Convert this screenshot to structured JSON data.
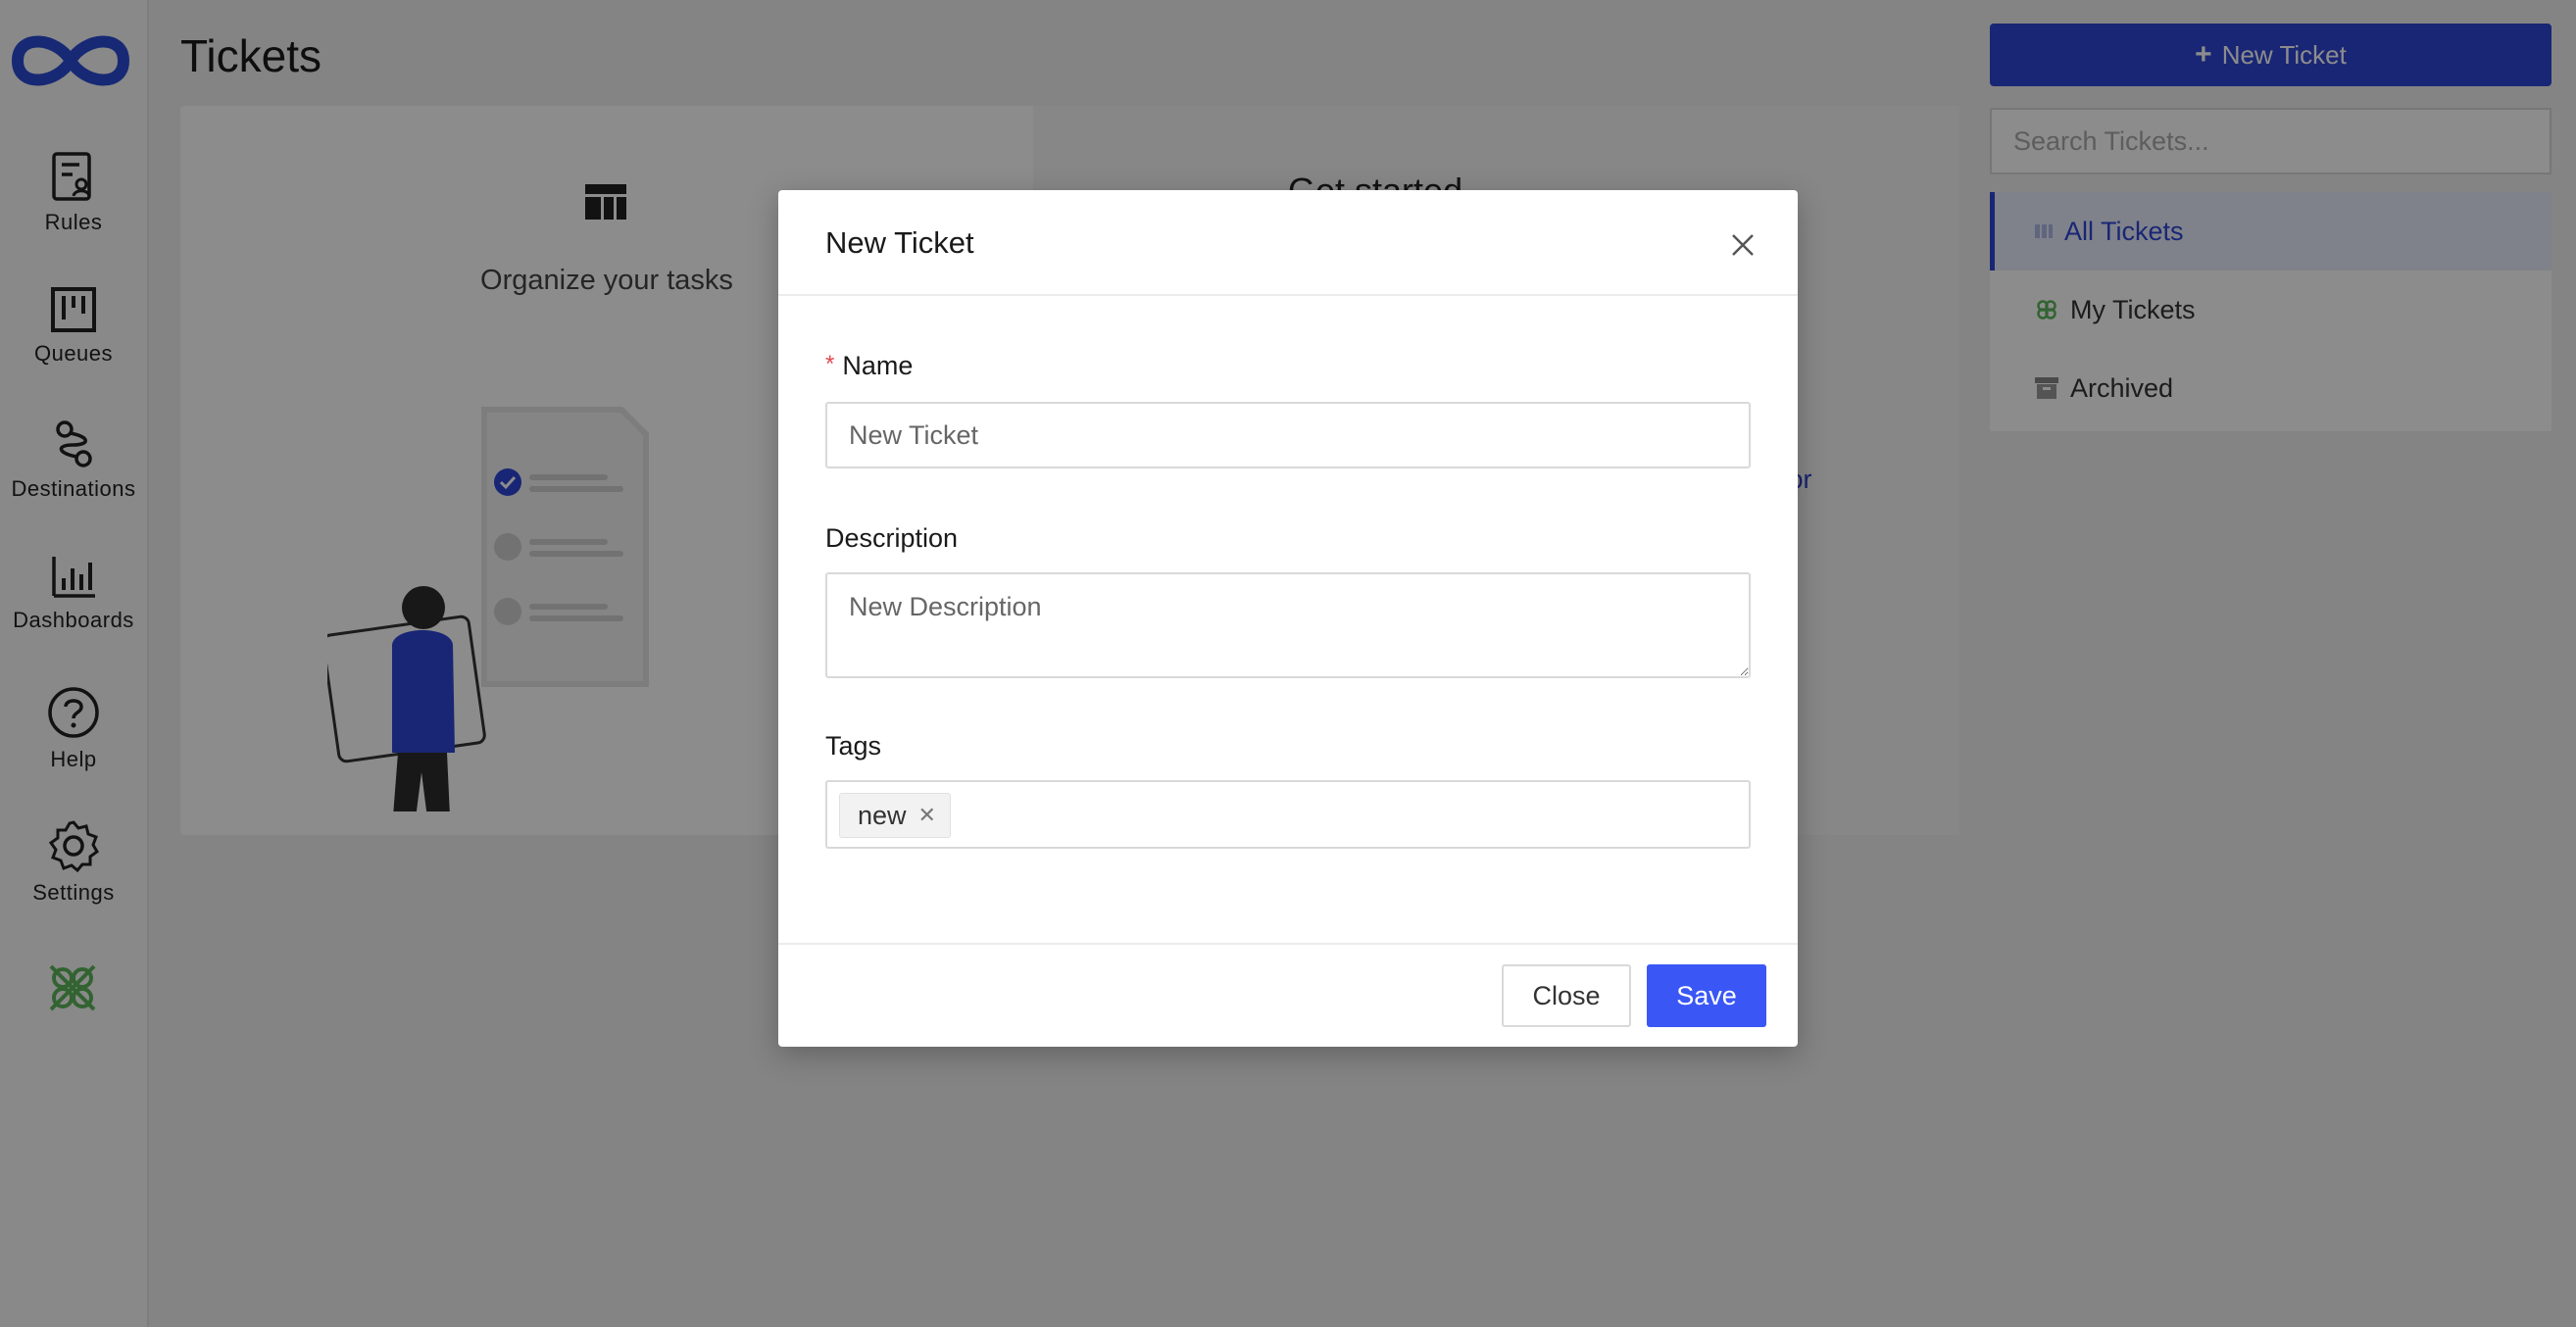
{
  "sidebar": {
    "items": [
      {
        "label": "Rules",
        "icon": "rules-icon"
      },
      {
        "label": "Queues",
        "icon": "queues-icon"
      },
      {
        "label": "Destinations",
        "icon": "destinations-icon"
      },
      {
        "label": "Dashboards",
        "icon": "dashboards-icon"
      },
      {
        "label": "Help",
        "icon": "help-icon"
      },
      {
        "label": "Settings",
        "icon": "settings-icon"
      }
    ],
    "brand_color": "#2a4bd4",
    "plugin_icon_color": "#5bb55a"
  },
  "main": {
    "title": "Tickets",
    "hero": {
      "organize_text": "Organize your tasks",
      "get_started": "Get started",
      "link_fragment": "s for"
    }
  },
  "right_panel": {
    "new_ticket_button": "New Ticket",
    "search_placeholder": "Search Tickets...",
    "menu": [
      {
        "label": "All Tickets",
        "active": true
      },
      {
        "label": "My Tickets",
        "active": false
      },
      {
        "label": "Archived",
        "active": false
      }
    ]
  },
  "modal": {
    "title": "New Ticket",
    "name_label": "Name",
    "name_placeholder": "New Ticket",
    "description_label": "Description",
    "description_placeholder": "New Description",
    "tags_label": "Tags",
    "tags": [
      "new"
    ],
    "close_button": "Close",
    "save_button": "Save"
  },
  "colors": {
    "accent": "#2f46d6",
    "save": "#3a57f5",
    "required": "#e5484d"
  }
}
